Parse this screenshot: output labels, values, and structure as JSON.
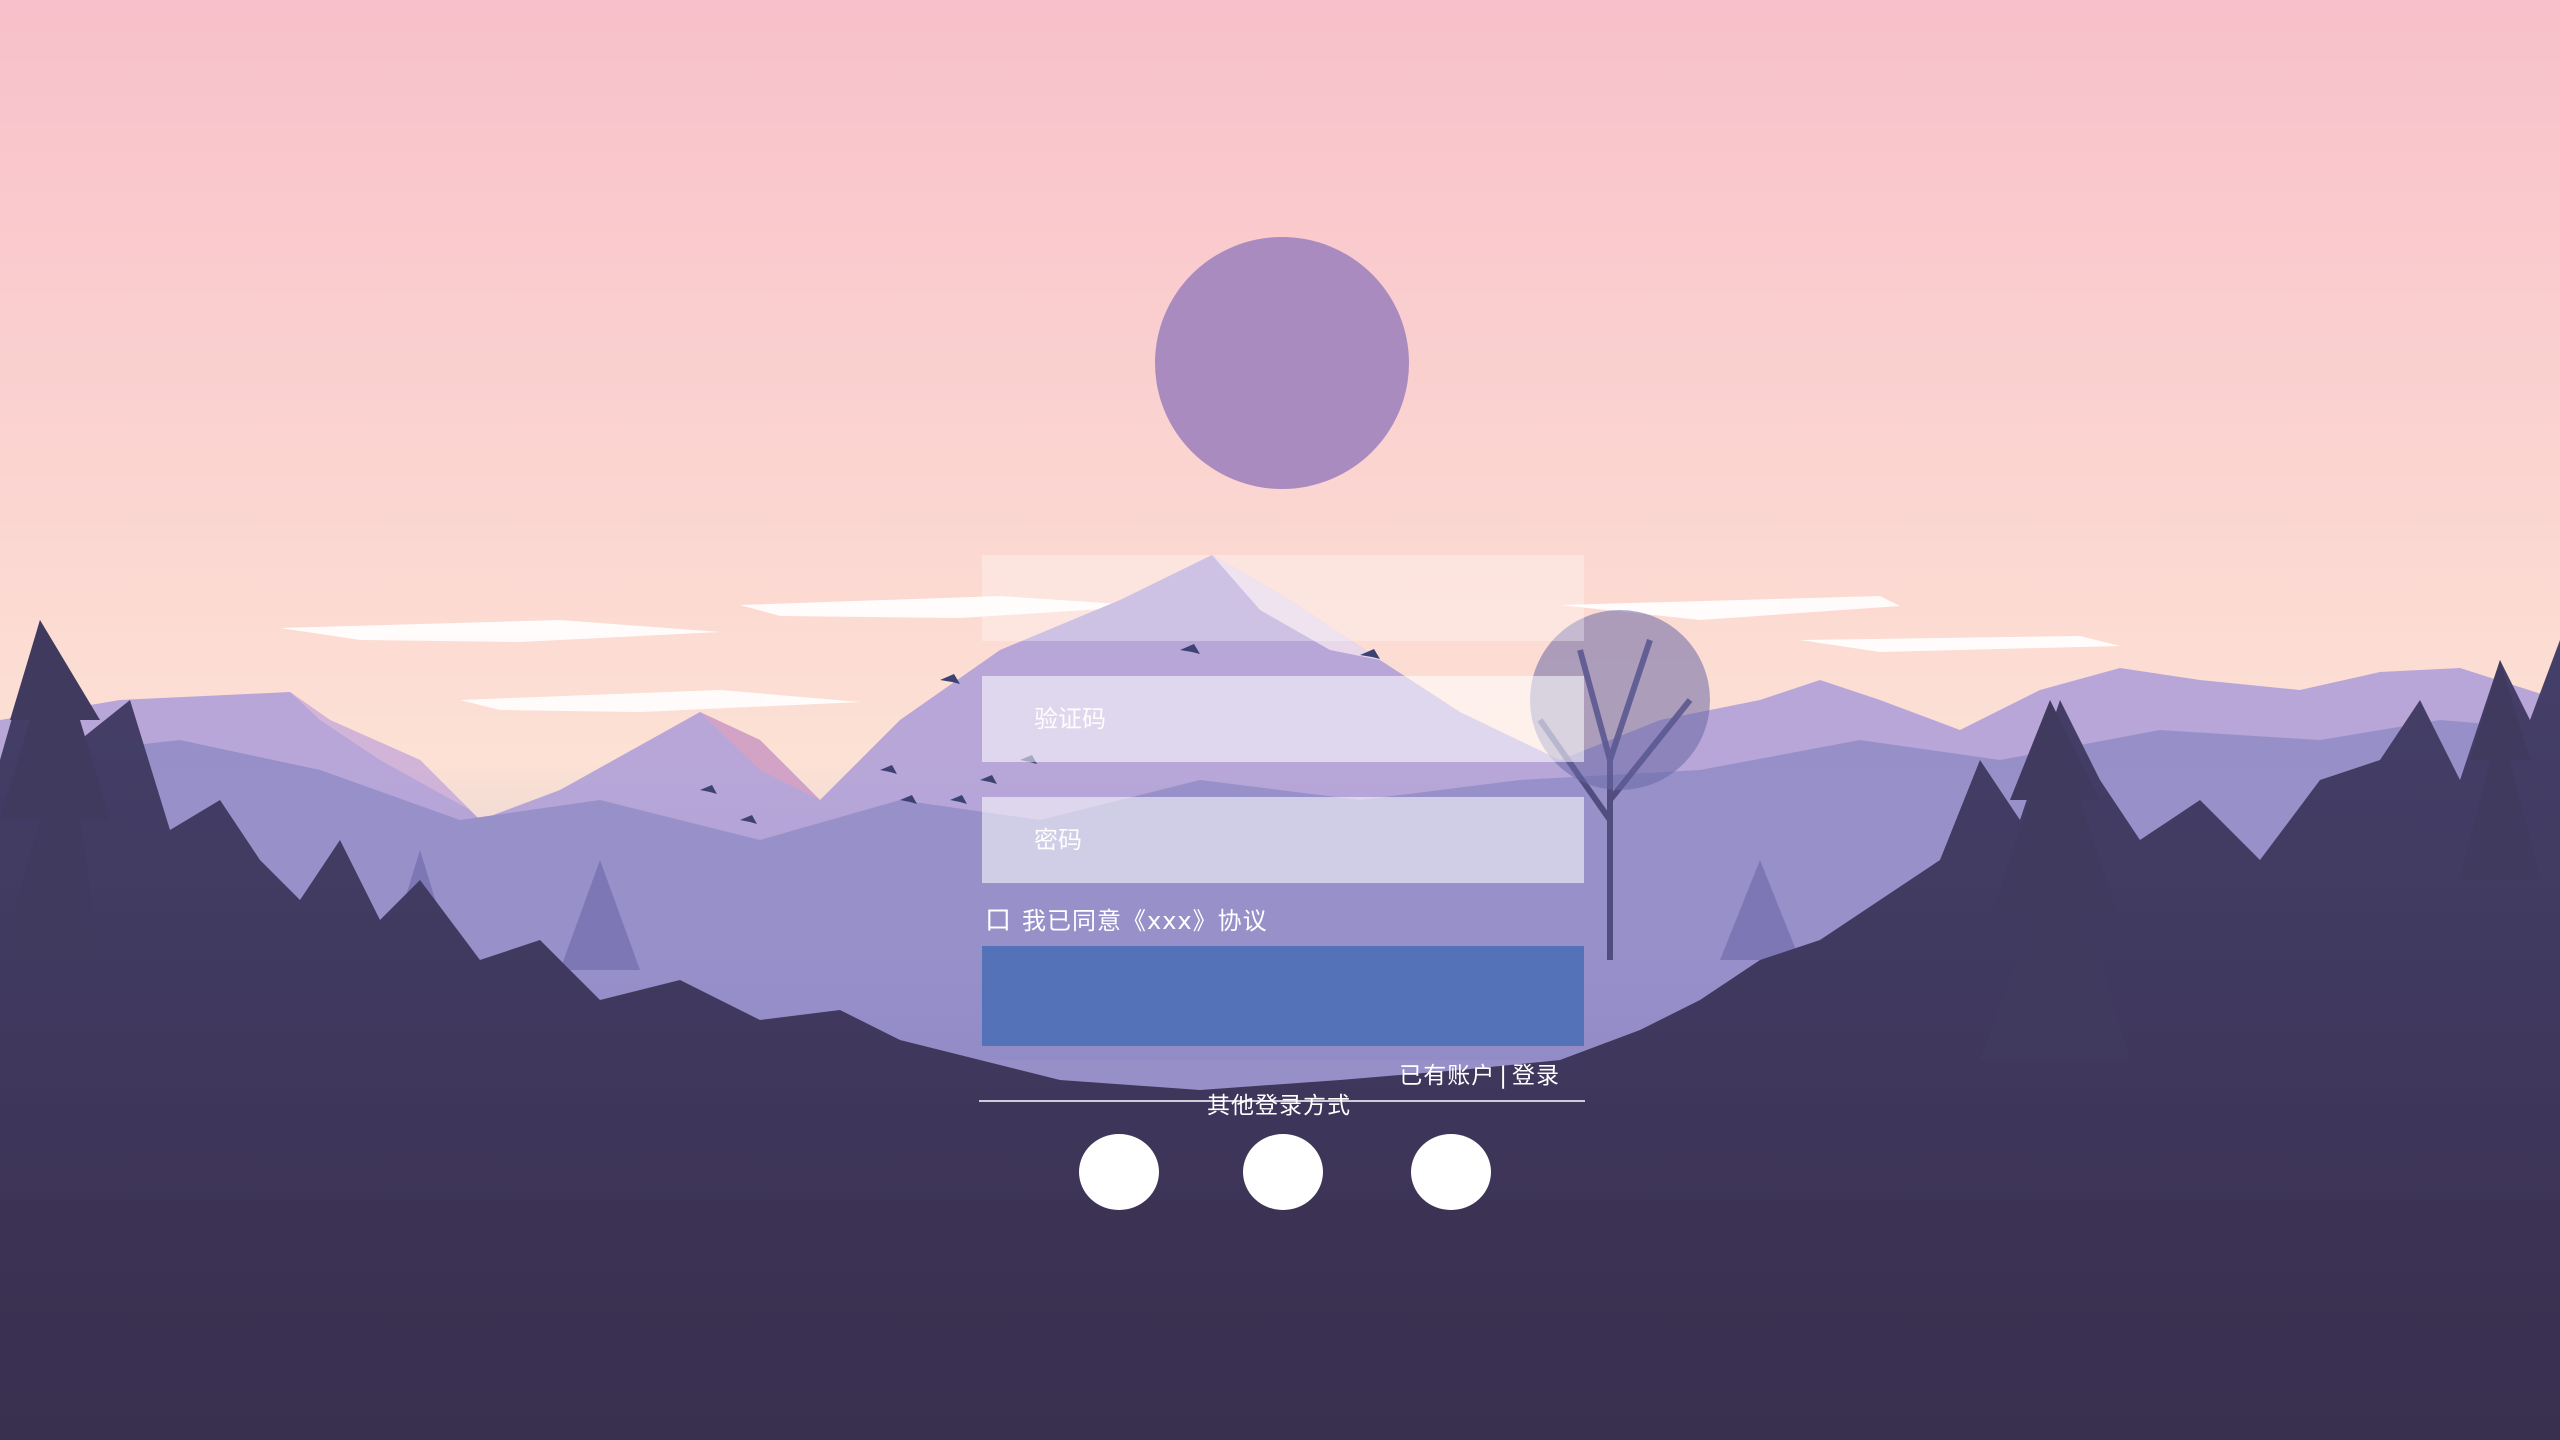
{
  "form": {
    "top_field_placeholder": "",
    "code_placeholder": "验证码",
    "password_placeholder": "密码",
    "agree_box": "口",
    "agree_text": "我已同意《xxx》协议",
    "submit_label": "",
    "account_text": "已有账户",
    "account_sep": "|",
    "login_link": "登录",
    "other_login_label": "其他登录方式"
  },
  "colors": {
    "avatar": "#a98bbf",
    "submit": "#5472b8",
    "sky_top": "#f8c3cd",
    "sky_bottom": "#fde3d3",
    "forest_dark": "#3b3551"
  },
  "social": [
    {
      "icon": "social-login-icon"
    },
    {
      "icon": "social-login-icon"
    },
    {
      "icon": "social-login-icon"
    }
  ]
}
